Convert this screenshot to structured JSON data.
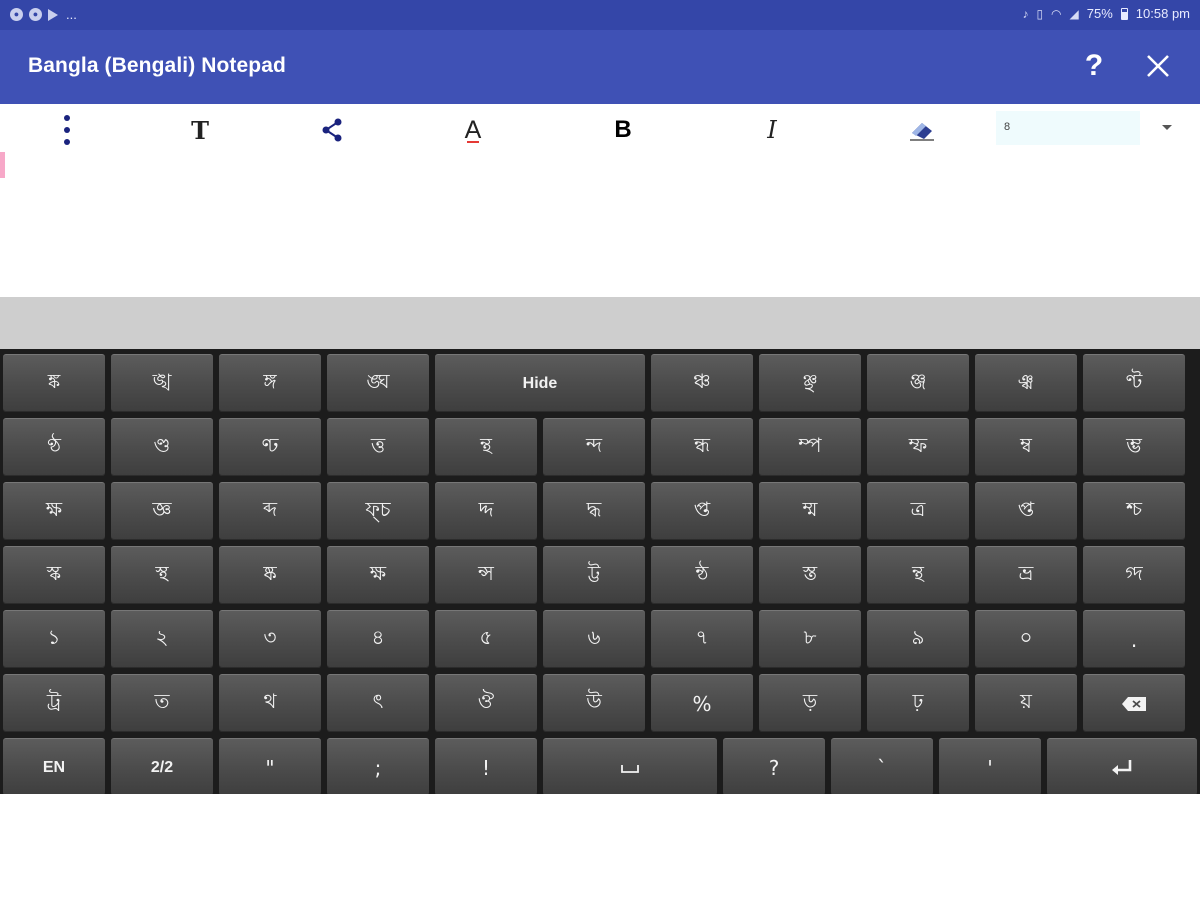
{
  "status_bar": {
    "battery": "75%",
    "time": "10:58 pm",
    "more": "..."
  },
  "app_bar": {
    "title": "Bangla (Bengali) Notepad",
    "help_label": "?"
  },
  "toolbar": {
    "font_button_label": "T",
    "text_color_label": "A",
    "bold_label": "B",
    "italic_label": "I",
    "font_size_value": "8"
  },
  "colors": {
    "status_bar": "#3446a8",
    "app_bar": "#3f51b5",
    "keyboard_bg": "#1c1c1c",
    "key": "#4c4c4c",
    "text_color_underline": "#e53935"
  },
  "keyboard": {
    "rows": [
      [
        "ঙ্ক",
        "ঙ্খ",
        "ঙ্গ",
        "ঙ্ঘ",
        "Hide",
        "ঞ্চ",
        "ঞ্ছ",
        "ঞ্জ",
        "ঞ্ঝ",
        "ণ্ট"
      ],
      [
        "ণ্ঠ",
        "ণ্ড",
        "ণ্ঢ",
        "ত্ত",
        "ন্থ",
        "ন্দ",
        "ন্ধ",
        "ম্প",
        "ম্ফ",
        "ম্ব",
        "ম্ভ"
      ],
      [
        "ক্ষ",
        "জ্ঞ",
        "ব্দ",
        "ফ্চ",
        "দ্দ",
        "দ্ধ",
        "প্ত",
        "ম্ম",
        "ত্র",
        "প্ত",
        "শ্চ"
      ],
      [
        "স্ক",
        "স্থ",
        "ষ্ক",
        "ক্ষ",
        "ন্স",
        "ট্ট",
        "ন্ঠ",
        "স্ত",
        "ন্থ",
        "ভ্র",
        "গ্দ"
      ],
      [
        "১",
        "২",
        "৩",
        "৪",
        "৫",
        "৬",
        "৭",
        "৮",
        "৯",
        "০",
        "."
      ],
      [
        "ট্র",
        "ত",
        "থ",
        "ৎ",
        "ঔ",
        "উ",
        "%",
        "ড়",
        "ঢ়",
        "য়",
        "backspace"
      ],
      [
        "EN",
        "2/2",
        "\"",
        ";",
        "!",
        "space",
        "?",
        "`",
        "'",
        "enter"
      ]
    ]
  }
}
